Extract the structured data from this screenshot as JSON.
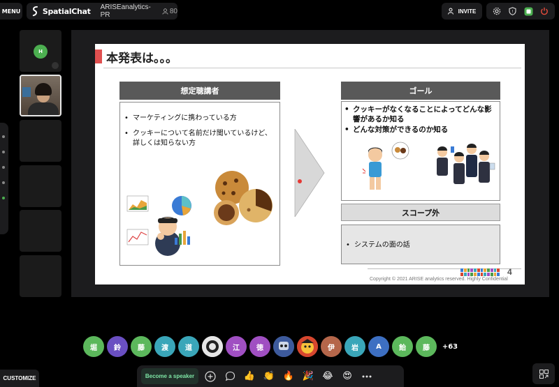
{
  "topbar": {
    "menu_label": "MENU",
    "app_name": "SpatialChat",
    "room_name": "ARISEanalytics-PR",
    "participant_count": "80",
    "invite_label": "INVITE",
    "icons": [
      "settings-icon",
      "shield-icon",
      "camera-toggle-icon",
      "power-icon"
    ]
  },
  "tiles": {
    "first_initial": "H"
  },
  "slide": {
    "title": "本発表は。。。",
    "left_header": "想定聴講者",
    "left_bullets": [
      "マーケティングに携わっている方",
      "クッキーについて名前だけ聞いているけど、詳しくは知らない方"
    ],
    "goal_header": "ゴール",
    "goal_bullets": [
      "クッキーがなくなることによってどんな影響があるか知る",
      "どんな対策ができるのか知る"
    ],
    "scope_header": "スコープ外",
    "scope_bullets": [
      "システムの面の話"
    ],
    "page_number": "4",
    "copyright": "Copyright © 2021 ARISE analytics reserved. Highly Confidential"
  },
  "avatars": [
    {
      "label": "堀",
      "color": "#5cb85c"
    },
    {
      "label": "鈴",
      "color": "#6a4fc2"
    },
    {
      "label": "藤",
      "color": "#5cb85c"
    },
    {
      "label": "渡",
      "color": "#3aa6b9"
    },
    {
      "label": "道",
      "color": "#3aa6b9"
    },
    {
      "label": "",
      "color": "#e6e6e6"
    },
    {
      "label": "江",
      "color": "#a04fc2"
    },
    {
      "label": "徳",
      "color": "#a04fc2"
    },
    {
      "label": "",
      "color": "#3d5a9c"
    },
    {
      "label": "",
      "color": "#d6462e"
    },
    {
      "label": "伊",
      "color": "#b5664a"
    },
    {
      "label": "岩",
      "color": "#3aa6b9"
    },
    {
      "label": "A",
      "color": "#3d6fc2"
    },
    {
      "label": "飴",
      "color": "#5cb85c"
    },
    {
      "label": "藤",
      "color": "#5cb85c"
    }
  ],
  "more_count": "+63",
  "bottombar": {
    "customize_label": "CUSTOMIZE",
    "speaker_label": "Become a speaker",
    "icons": [
      "add-icon",
      "chat-icon",
      "thumbs-up-icon",
      "clap-icon",
      "fire-icon",
      "party-icon",
      "laugh-icon",
      "heart-eyes-icon",
      "more-icon"
    ],
    "emojis": [
      "👍",
      "👏",
      "🔥",
      "🎉",
      "😂",
      "😍"
    ]
  },
  "colors": {
    "accent_green": "#4caf50",
    "title_red": "#e05050",
    "box_header": "#595959"
  }
}
